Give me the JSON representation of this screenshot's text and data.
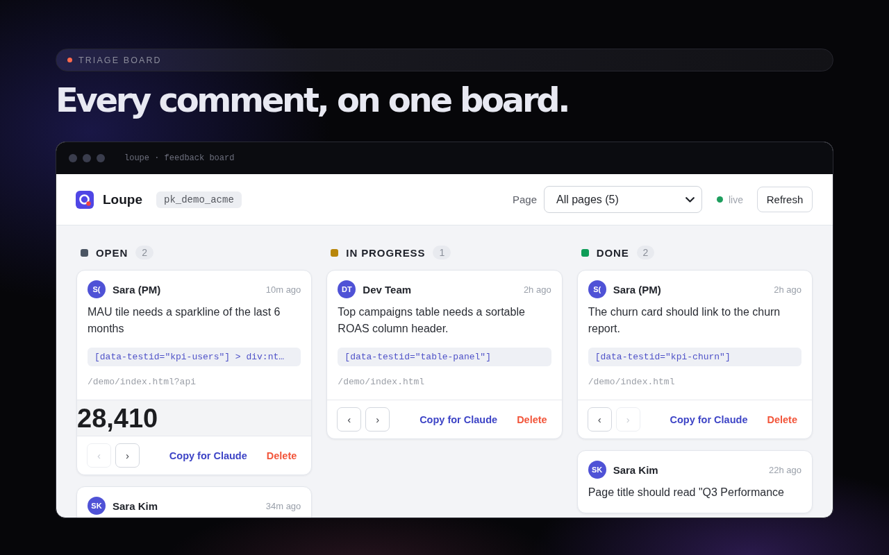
{
  "eyebrow": {
    "label": "TRIAGE BOARD"
  },
  "headline": "Every comment, on one board.",
  "window": {
    "title": "loupe · feedback board"
  },
  "app": {
    "brand": "Loupe",
    "project_key": "pk_demo_acme",
    "page_filter": {
      "label": "Page",
      "value": "All pages (5)"
    },
    "status": {
      "label": "live"
    },
    "refresh_button": "Refresh"
  },
  "columns": [
    {
      "title": "OPEN",
      "count": "2",
      "color": "#4b5563",
      "cards": [
        {
          "initials": "S(",
          "author": "Sara (PM)",
          "time": "10m ago",
          "message": "MAU tile needs a sparkline of the last 6 months",
          "selector": "[data-testid=\"kpi-users\"] > div:nt…",
          "path": "/demo/index.html?api",
          "preview": "28,410",
          "prev": {
            "label": "‹",
            "disabled": true
          },
          "next": {
            "label": "›",
            "disabled": false
          },
          "actions": [
            {
              "kind": "copy",
              "label": "Copy for Claude"
            },
            {
              "kind": "delete",
              "label": "Delete"
            }
          ]
        },
        {
          "initials": "SK",
          "author": "Sara Kim",
          "time": "34m ago"
        }
      ]
    },
    {
      "title": "IN PROGRESS",
      "count": "1",
      "color": "#b8860b",
      "cards": [
        {
          "initials": "DT",
          "author": "Dev Team",
          "time": "2h ago",
          "message": "Top campaigns table needs a sortable ROAS column header.",
          "selector": "[data-testid=\"table-panel\"]",
          "path": "/demo/index.html",
          "prev": {
            "label": "‹",
            "disabled": false
          },
          "next": {
            "label": "›",
            "disabled": false
          },
          "actions": [
            {
              "kind": "copy",
              "label": "Copy for Claude"
            },
            {
              "kind": "delete",
              "label": "Delete"
            }
          ]
        }
      ]
    },
    {
      "title": "DONE",
      "count": "2",
      "color": "#0f9d58",
      "cards": [
        {
          "initials": "S(",
          "author": "Sara (PM)",
          "time": "2h ago",
          "message": "The churn card should link to the churn report.",
          "selector": "[data-testid=\"kpi-churn\"]",
          "path": "/demo/index.html",
          "prev": {
            "label": "‹",
            "disabled": false
          },
          "next": {
            "label": "›",
            "disabled": true
          },
          "actions": [
            {
              "kind": "copy",
              "label": "Copy for Claude"
            },
            {
              "kind": "delete",
              "label": "Delete"
            }
          ]
        },
        {
          "initials": "SK",
          "author": "Sara Kim",
          "time": "22h ago",
          "message": "Page title should read \"Q3 Performance"
        }
      ]
    }
  ]
}
